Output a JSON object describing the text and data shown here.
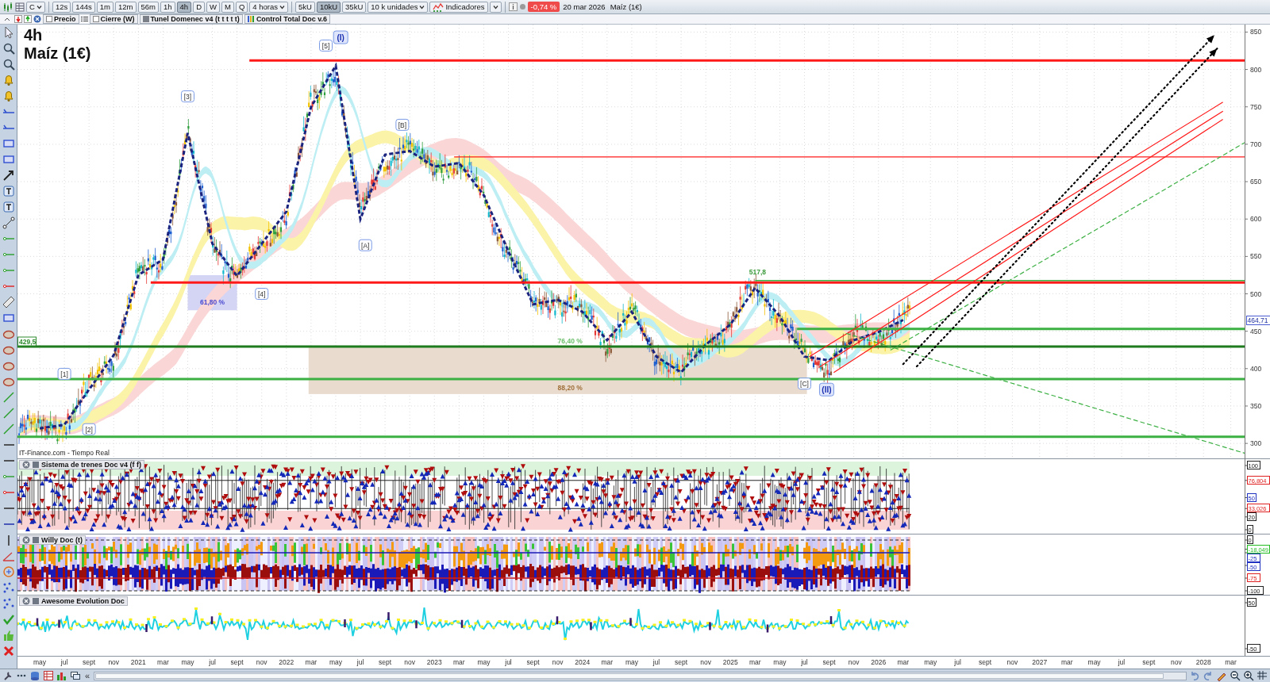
{
  "toolbar": {
    "symbol": "C",
    "intervals": [
      {
        "label": "12s",
        "selected": false
      },
      {
        "label": "144s",
        "selected": false
      },
      {
        "label": "1m",
        "selected": false
      },
      {
        "label": "12m",
        "selected": false
      },
      {
        "label": "56m",
        "selected": false
      },
      {
        "label": "1h",
        "selected": false
      },
      {
        "label": "4h",
        "selected": true
      },
      {
        "label": "D",
        "selected": false
      },
      {
        "label": "W",
        "selected": false
      },
      {
        "label": "M",
        "selected": false
      },
      {
        "label": "Q",
        "selected": false
      }
    ],
    "interval_menu": "4 horas",
    "units": [
      {
        "label": "5kU",
        "selected": false
      },
      {
        "label": "10kU",
        "selected": true
      },
      {
        "label": "35kU",
        "selected": false
      }
    ],
    "units_menu": "10 k unidades",
    "indicators_button": "Indicadores",
    "change_badge": "-0,74 %",
    "date": "20 mar 2026",
    "instrument": "Maíz (1€)"
  },
  "indicator_bar": [
    {
      "kind": "checkbox",
      "label": "Precio",
      "checked": false
    },
    {
      "kind": "checkbox",
      "label": "Cierre (W)",
      "checked": false
    },
    {
      "kind": "swatch",
      "label": "Tunel Domenec v4 (t t t t t)"
    },
    {
      "kind": "bars",
      "label": "Control Total Doc v.6"
    }
  ],
  "price_panel": {
    "interval_label": "4h",
    "title": "Maíz (1€)",
    "source": "IT-Finance.com - Tiempo Real",
    "last_price": "464,71",
    "price_tag": "429,5",
    "level_label": "517,8",
    "fib_labels": [
      "61,80 %",
      "76,40 %",
      "88,20 %"
    ],
    "wave_labels": [
      {
        "text": "[1]",
        "major": false
      },
      {
        "text": "[2]",
        "major": false
      },
      {
        "text": "[3]",
        "major": false
      },
      {
        "text": "[4]",
        "major": false
      },
      {
        "text": "[5]",
        "major": false
      },
      {
        "text": "(I)",
        "major": true
      },
      {
        "text": "[A]",
        "major": false
      },
      {
        "text": "[B]",
        "major": false
      },
      {
        "text": "[C]",
        "major": false
      },
      {
        "text": "(II)",
        "major": true
      }
    ],
    "y_axis": [
      "850",
      "800",
      "750",
      "700",
      "650",
      "600",
      "550",
      "500",
      "450",
      "400",
      "350",
      "300"
    ]
  },
  "indicators": [
    {
      "kind": "trains",
      "title": "Sistema de trenes Doc v4 (f f)",
      "ticks": [
        {
          "label": "100",
          "color": "#222222"
        },
        {
          "label": "76,804",
          "color": "#e02020"
        },
        {
          "label": "50",
          "color": "#2030c0"
        },
        {
          "label": "33,026",
          "color": "#e02020"
        },
        {
          "label": "20",
          "color": "#222222"
        },
        {
          "label": "0",
          "color": "#222222"
        }
      ]
    },
    {
      "kind": "willy",
      "title": "Willy Doc (t)",
      "ticks": [
        {
          "label": "0",
          "color": "#222222"
        },
        {
          "label": "-18,049",
          "color": "#22bb22"
        },
        {
          "label": "-25",
          "color": "#2030c0"
        },
        {
          "label": "-50",
          "color": "#2030c0"
        },
        {
          "label": "-75",
          "color": "#e02020"
        },
        {
          "label": "-100",
          "color": "#222222"
        }
      ]
    },
    {
      "kind": "awesome",
      "title": "Awesome Evolution Doc",
      "ticks": [
        {
          "label": "50",
          "color": "#222222"
        },
        {
          "label": "-50",
          "color": "#222222"
        }
      ]
    }
  ],
  "time_axis": [
    "may",
    "jul",
    "sept",
    "nov",
    "2021",
    "mar",
    "may",
    "jul",
    "sept",
    "nov",
    "2022",
    "mar",
    "may",
    "jul",
    "sept",
    "nov",
    "2023",
    "mar",
    "may",
    "jul",
    "sept",
    "nov",
    "2024",
    "mar",
    "may",
    "jul",
    "sept",
    "nov",
    "2025",
    "mar",
    "may",
    "jul",
    "sept",
    "nov",
    "2026",
    "mar",
    "may",
    "jul",
    "sept",
    "nov",
    "2027",
    "mar",
    "may",
    "jul",
    "sept",
    "nov",
    "2028",
    "mar"
  ],
  "bottom_bar": {
    "scroll_glyph": "«"
  }
}
